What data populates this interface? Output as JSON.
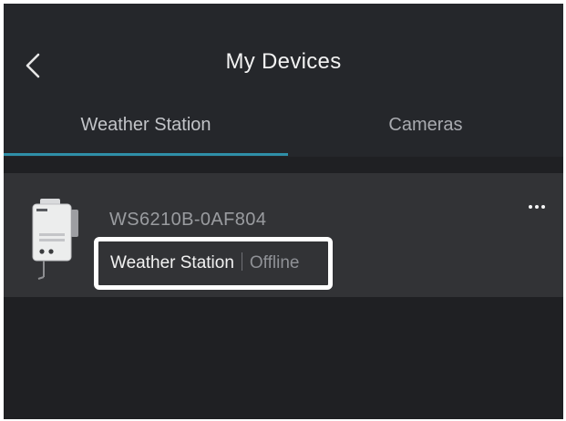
{
  "header": {
    "title": "My Devices",
    "back_icon": "chevron-left-icon"
  },
  "tabs": [
    {
      "label": "Weather Station",
      "active": true
    },
    {
      "label": "Cameras",
      "active": false
    }
  ],
  "colors": {
    "background": "#1f2023",
    "header": "#25272b",
    "row": "#323336",
    "accent": "#2f8fa8",
    "text_primary": "#f2f2f2",
    "text_secondary": "#9a9ca0"
  },
  "devices": [
    {
      "name": "WS6210B-0AF804",
      "type": "Weather Station",
      "status": "Offline",
      "image_icon": "weather-station-device-icon",
      "more_icon": "more-horizontal-icon"
    }
  ]
}
